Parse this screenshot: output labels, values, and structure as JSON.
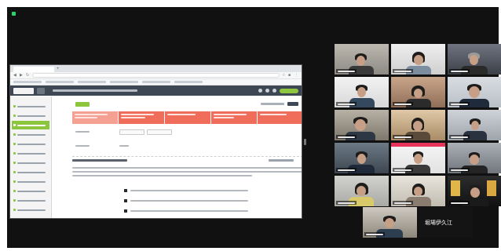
{
  "window": {
    "title": ""
  },
  "colors": {
    "meeting_bg": "#111111",
    "app_header": "#3d4854",
    "accent_green": "#8cc63e",
    "step_red": "#f06d5b",
    "speaker_outline": "#b6e34b",
    "recording_dot": "#2bd46a"
  },
  "browser": {
    "icons": [
      "back-icon",
      "forward-icon",
      "reload-icon",
      "star-icon",
      "extensions-icon",
      "menu-icon"
    ]
  },
  "app": {
    "sidebar_item_count": 12,
    "active_sidebar_index": 2,
    "process_steps": 5
  },
  "participants": {
    "speaker_name": "堀場伊久江",
    "tile_count": 17
  }
}
